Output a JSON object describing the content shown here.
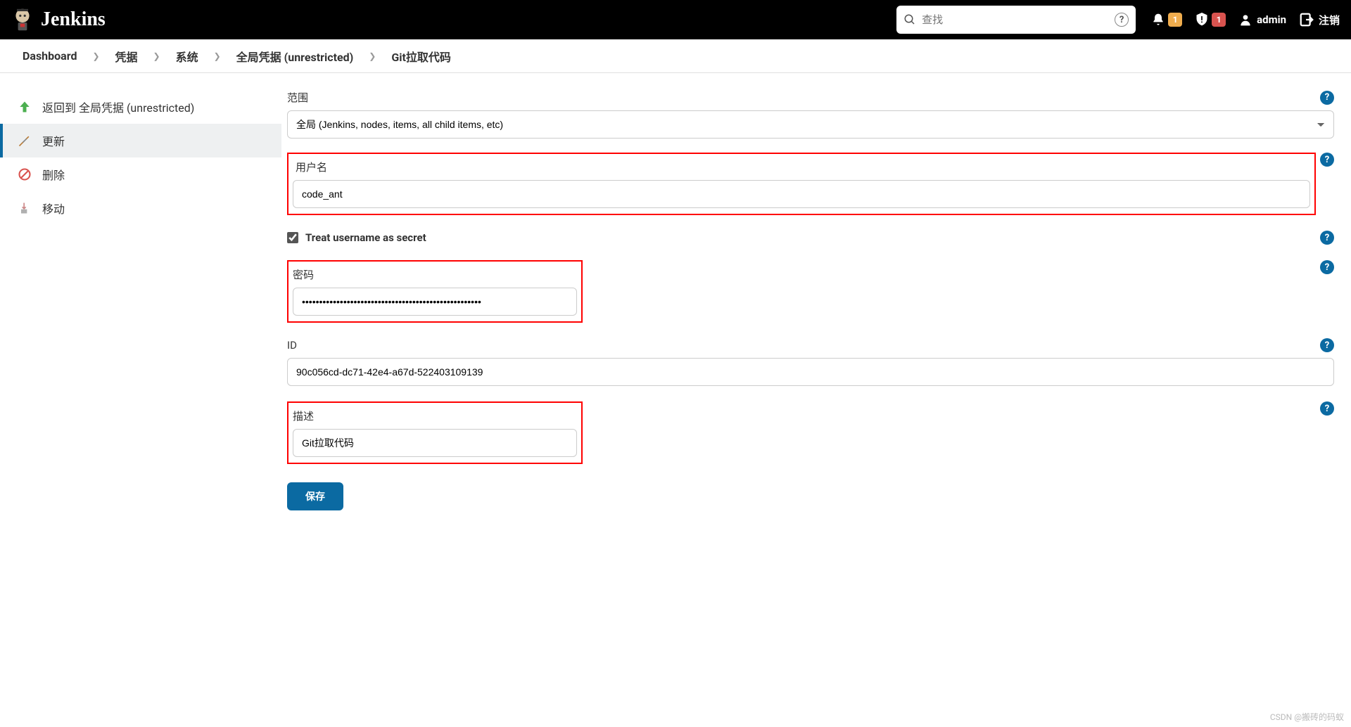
{
  "header": {
    "brand": "Jenkins",
    "search_placeholder": "查找",
    "notif_badge": "1",
    "alert_badge": "1",
    "user": "admin",
    "logout": "注销"
  },
  "breadcrumbs": {
    "items": [
      "Dashboard",
      "凭据",
      "系统",
      "全局凭据 (unrestricted)",
      "Git拉取代码"
    ]
  },
  "sidebar": {
    "items": [
      {
        "label": "返回到 全局凭据 (unrestricted)"
      },
      {
        "label": "更新"
      },
      {
        "label": "删除"
      },
      {
        "label": "移动"
      }
    ]
  },
  "form": {
    "scope_label": "范围",
    "scope_value": "全局 (Jenkins, nodes, items, all child items, etc)",
    "username_label": "用户名",
    "username_value": "code_ant",
    "treat_secret_label": "Treat username as secret",
    "treat_secret_checked": true,
    "password_label": "密码",
    "password_value": "••••••••••••••••••••••••••••••••••••••••••••••••••••",
    "id_label": "ID",
    "id_value": "90c056cd-dc71-42e4-a67d-522403109139",
    "desc_label": "描述",
    "desc_value": "Git拉取代码",
    "save_label": "保存"
  },
  "watermark": "CSDN @搬砖的码蚁"
}
